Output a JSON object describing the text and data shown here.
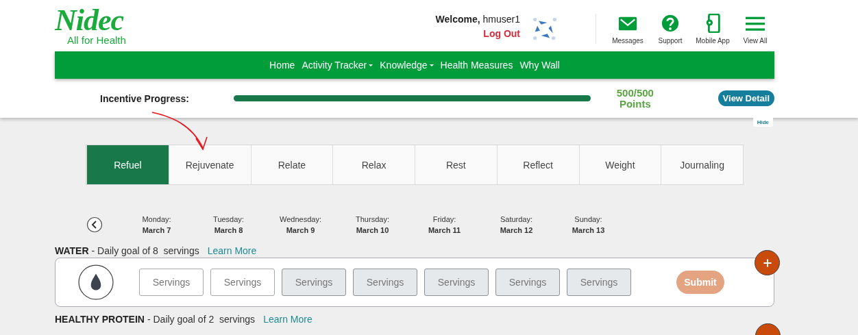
{
  "header": {
    "logo": {
      "name": "Nidec",
      "tagline": "All for Health"
    },
    "welcome": {
      "label": "Welcome,",
      "user": "hmuser1"
    },
    "logout": "Log Out",
    "icons": [
      {
        "kind": "messages",
        "label": "Messages"
      },
      {
        "kind": "support",
        "label": "Support"
      },
      {
        "kind": "mobile",
        "label": "Mobile App"
      },
      {
        "kind": "menu",
        "label": "View All"
      }
    ]
  },
  "nav": [
    {
      "label": "Home",
      "dropdown": false
    },
    {
      "label": "Activity Tracker",
      "dropdown": true
    },
    {
      "label": "Knowledge",
      "dropdown": true
    },
    {
      "label": "Health Measures",
      "dropdown": false
    },
    {
      "label": "Why Wall",
      "dropdown": false
    }
  ],
  "progress": {
    "label": "Incentive Progress:",
    "level": 1,
    "points": "500/500",
    "unit": "Points",
    "button": "View Detail",
    "hide": "Hide"
  },
  "tabs": [
    {
      "label": "Refuel",
      "selected": true
    },
    {
      "label": "Rejuvenate",
      "selected": false
    },
    {
      "label": "Relate",
      "selected": false
    },
    {
      "label": "Relax",
      "selected": false
    },
    {
      "label": "Rest",
      "selected": false
    },
    {
      "label": "Reflect",
      "selected": false
    },
    {
      "label": "Weight",
      "selected": false
    },
    {
      "label": "Journaling",
      "selected": false
    }
  ],
  "days": [
    {
      "day": "Monday:",
      "date": "March 7"
    },
    {
      "day": "Tuesday:",
      "date": "March 8"
    },
    {
      "day": "Wednesday:",
      "date": "March 9"
    },
    {
      "day": "Thursday:",
      "date": "March 10"
    },
    {
      "day": "Friday:",
      "date": "March 11"
    },
    {
      "day": "Saturday:",
      "date": "March 12"
    },
    {
      "day": "Sunday:",
      "date": "March 13"
    }
  ],
  "trackers": [
    {
      "title": "WATER",
      "goal": "- Daily goal of 8  servings",
      "link": "Learn More",
      "inputs": [
        {
          "placeholder": "Servings",
          "disabled": false
        },
        {
          "placeholder": "Servings",
          "disabled": false
        },
        {
          "placeholder": "Servings",
          "disabled": true
        },
        {
          "placeholder": "Servings",
          "disabled": true
        },
        {
          "placeholder": "Servings",
          "disabled": true
        },
        {
          "placeholder": "Servings",
          "disabled": true
        },
        {
          "placeholder": "Servings",
          "disabled": true
        }
      ],
      "submit": {
        "label": "Submit",
        "disabled": true
      }
    },
    {
      "title": "HEALTHY PROTEIN",
      "goal": "- Daily goal of 2  servings",
      "link": "Learn More"
    }
  ]
}
